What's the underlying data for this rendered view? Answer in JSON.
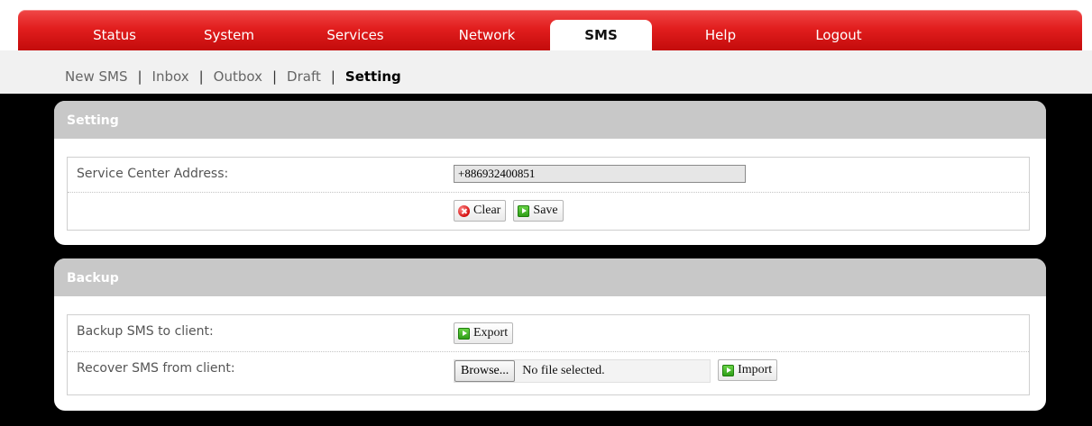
{
  "nav": {
    "tabs": [
      {
        "label": "Status"
      },
      {
        "label": "System"
      },
      {
        "label": "Services"
      },
      {
        "label": "Network"
      },
      {
        "label": "SMS"
      },
      {
        "label": "Help"
      },
      {
        "label": "Logout"
      }
    ],
    "active": "SMS"
  },
  "subnav": {
    "items": [
      {
        "label": "New SMS"
      },
      {
        "label": "Inbox"
      },
      {
        "label": "Outbox"
      },
      {
        "label": "Draft"
      },
      {
        "label": "Setting"
      }
    ],
    "separator": "|",
    "active": "Setting"
  },
  "setting": {
    "title": "Setting",
    "sca_label": "Service Center Address:",
    "sca_value": "+886932400851",
    "clear_label": "Clear",
    "save_label": "Save"
  },
  "backup": {
    "title": "Backup",
    "backup_label": "Backup SMS to client:",
    "export_label": "Export",
    "recover_label": "Recover SMS from client:",
    "browse_label": "Browse...",
    "file_status": "No file selected.",
    "import_label": "Import"
  },
  "colors": {
    "nav_red": "#e21e1e",
    "content_bg": "#000000",
    "panel_header": "#c8c8c8"
  },
  "icons": {
    "clear": "clear-icon",
    "save": "save-icon",
    "export": "export-icon",
    "import": "import-icon"
  }
}
